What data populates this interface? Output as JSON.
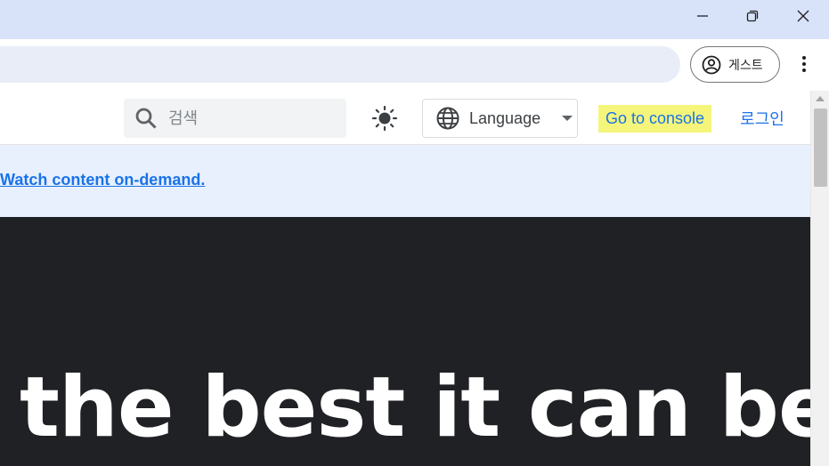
{
  "window": {
    "minimize_icon": "minimize-icon",
    "restore_icon": "restore-icon",
    "close_icon": "close-icon"
  },
  "browser": {
    "profile_label": "게스트",
    "profile_icon": "account-circle-icon",
    "menu_icon": "more-vert-icon"
  },
  "header": {
    "search_placeholder": "검색",
    "search_icon": "search-icon",
    "theme_icon": "sun-icon",
    "language_label": "Language",
    "language_icon": "globe-icon",
    "console_label": "Go to console",
    "login_label": "로그인"
  },
  "banner": {
    "link_text": "Watch content on-demand."
  },
  "hero": {
    "heading": "the best it can be"
  },
  "colors": {
    "accent": "#1a73e8",
    "console_bg": "#f4f57a",
    "hero_bg": "#202124",
    "banner_bg": "#e8f0fe"
  }
}
